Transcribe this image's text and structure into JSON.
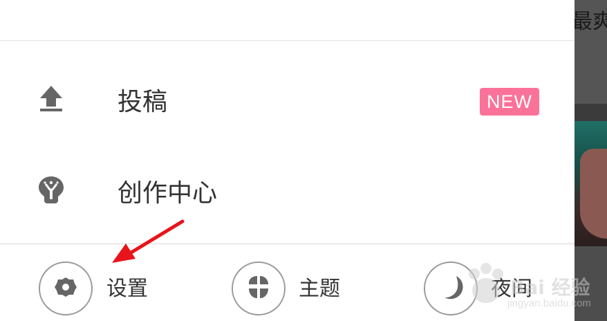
{
  "drawer": {
    "menu": [
      {
        "label": "投稿",
        "icon": "upload-icon",
        "badge": "NEW",
        "badge_color": "#fb7299"
      },
      {
        "label": "创作中心",
        "icon": "lightbulb-icon"
      }
    ],
    "bottom": [
      {
        "label": "设置",
        "icon": "gear-icon"
      },
      {
        "label": "主题",
        "icon": "theme-icon"
      },
      {
        "label": "夜间",
        "icon": "moon-icon"
      }
    ]
  },
  "background": {
    "peek_text": "最爽"
  },
  "annotation": {
    "arrow_color": "#e8141b",
    "target": "设置"
  },
  "watermark": {
    "text": "Bai 经验",
    "sub": "jingyan.baidu.com"
  },
  "colors": {
    "accent": "#fb7299",
    "icon_gray": "#666666",
    "divider": "#e3e3e3"
  }
}
